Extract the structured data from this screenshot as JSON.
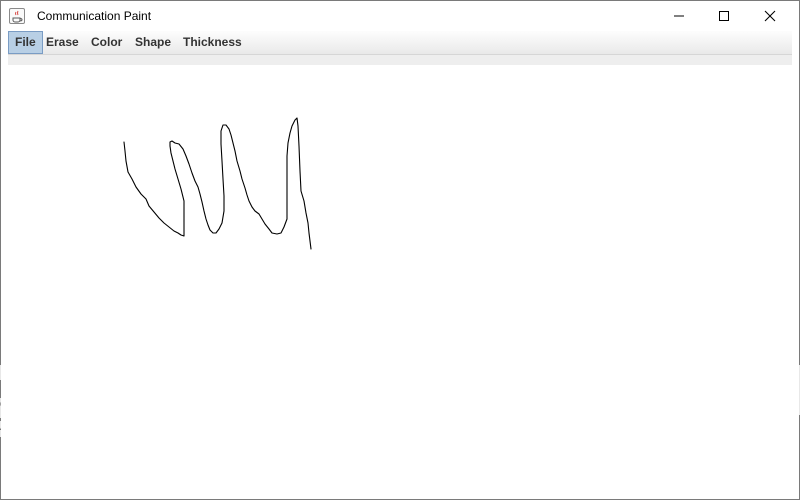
{
  "window": {
    "title": "Communication Paint",
    "icon": "java-cup-icon",
    "controls": [
      "minimize-icon",
      "maximize-icon",
      "close-icon"
    ]
  },
  "menu": {
    "items": [
      {
        "label": "File",
        "active": true
      },
      {
        "label": "Erase",
        "active": false
      },
      {
        "label": "Color",
        "active": false
      },
      {
        "label": "Shape",
        "active": false
      },
      {
        "label": "Thickness",
        "active": false
      }
    ]
  },
  "canvas": {
    "background": "#ffffff",
    "stroke_color": "#000000"
  },
  "background_window": {
    "visible_fragments": [
      "er",
      "A"
    ]
  }
}
